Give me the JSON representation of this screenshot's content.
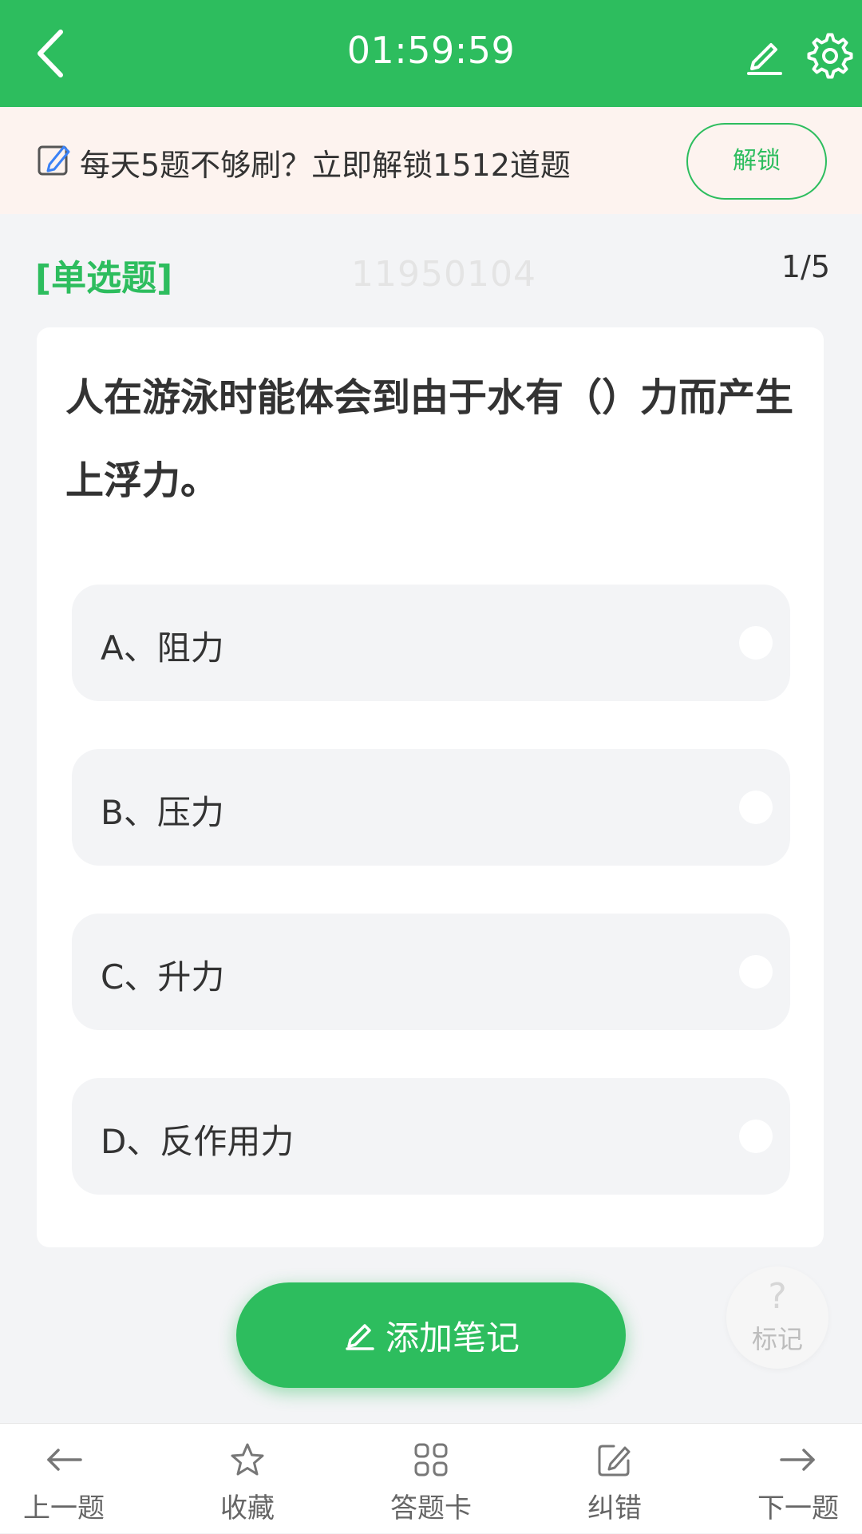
{
  "header": {
    "timer": "01:59:59",
    "bg_color": "#2dbd5e"
  },
  "promo": {
    "text": "每天5题不够刷？立即解锁1512道题",
    "unlock_label": "解锁",
    "icon": "edit-note-icon"
  },
  "question": {
    "type": "[单选题]",
    "id": "11950104",
    "progress": "1/5",
    "text": "人在游泳时能体会到由于水有（）力而产生上浮力。",
    "options": [
      {
        "label": "A、阻力"
      },
      {
        "label": "B、压力"
      },
      {
        "label": "C、升力"
      },
      {
        "label": "D、反作用力"
      }
    ]
  },
  "actions": {
    "add_note": "添加笔记",
    "mark_symbol": "?",
    "mark_label": "标记"
  },
  "bottom_nav": {
    "items": [
      {
        "label": "上一题",
        "icon": "arrow-left-icon"
      },
      {
        "label": "收藏",
        "icon": "star-icon"
      },
      {
        "label": "答题卡",
        "icon": "grid-icon"
      },
      {
        "label": "纠错",
        "icon": "edit-icon"
      },
      {
        "label": "下一题",
        "icon": "arrow-right-icon"
      }
    ]
  }
}
